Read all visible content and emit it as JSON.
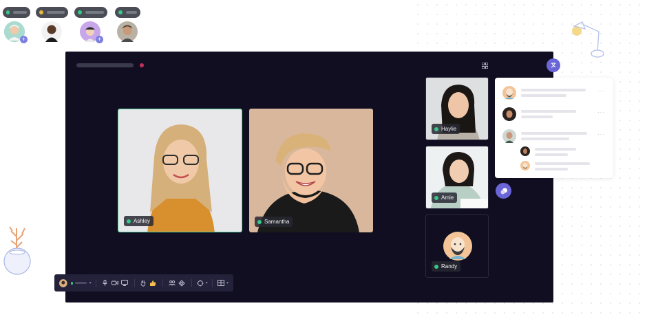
{
  "participants_top": [
    {
      "status_color": "#37c88a",
      "avatar": "user-avatar-1",
      "has_invite": true
    },
    {
      "status_color": "#e9b843",
      "avatar": "user-avatar-2",
      "has_invite": false
    },
    {
      "status_color": "#37c88a",
      "avatar": "user-avatar-3",
      "has_invite": true
    },
    {
      "status_color": "#37c88a",
      "avatar": "user-avatar-4",
      "has_invite": false
    }
  ],
  "main_tiles": [
    {
      "name": "Ashley",
      "status_color": "#37c88a",
      "active_speaker": true
    },
    {
      "name": "Samantha",
      "status_color": "#37c88a",
      "active_speaker": false
    }
  ],
  "side_tiles": [
    {
      "name": "Haylie",
      "status_color": "#37c88a"
    },
    {
      "name": "Amie",
      "status_color": "#37c88a"
    },
    {
      "name": "Randy",
      "status_color": "#37c88a"
    }
  ],
  "toolbar": {
    "icons": [
      "microphone-icon",
      "camera-icon",
      "screen-share-icon",
      "raise-hand-icon",
      "thumbs-up-icon",
      "participants-icon",
      "effects-icon",
      "reactions-icon",
      "layout-grid-icon"
    ]
  },
  "colors": {
    "window_bg": "#100e20",
    "accent": "#6a66d8",
    "status_online": "#37c88a",
    "recording": "#c0325a"
  }
}
